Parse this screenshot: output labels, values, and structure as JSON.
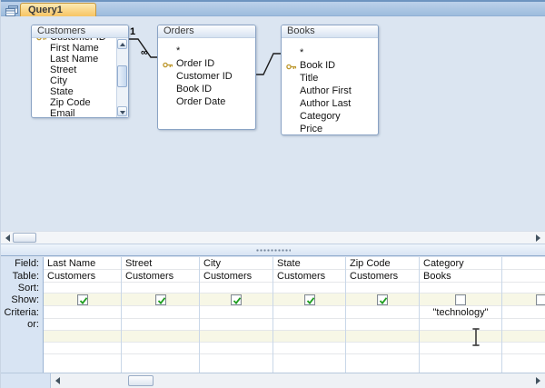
{
  "window": {
    "tab_title": "Query1"
  },
  "diagram": {
    "tables": [
      {
        "name": "Customers",
        "fields": [
          {
            "label": "Customer ID",
            "key": true
          },
          {
            "label": "First Name"
          },
          {
            "label": "Last Name"
          },
          {
            "label": "Street"
          },
          {
            "label": "City"
          },
          {
            "label": "State"
          },
          {
            "label": "Zip Code"
          },
          {
            "label": "Email"
          }
        ],
        "scrolled": true
      },
      {
        "name": "Orders",
        "fields": [
          {
            "label": "*"
          },
          {
            "label": "Order ID",
            "key": true
          },
          {
            "label": "Customer ID"
          },
          {
            "label": "Book ID"
          },
          {
            "label": "Order Date"
          }
        ]
      },
      {
        "name": "Books",
        "fields": [
          {
            "label": "*"
          },
          {
            "label": "Book ID",
            "key": true
          },
          {
            "label": "Title"
          },
          {
            "label": "Author First"
          },
          {
            "label": "Author Last"
          },
          {
            "label": "Category"
          },
          {
            "label": "Price"
          }
        ]
      }
    ],
    "relationships": [
      {
        "from": "Customers",
        "to": "Orders",
        "from_cardinality": "1",
        "to_cardinality": "∞"
      },
      {
        "from": "Orders",
        "to": "Books",
        "from_cardinality": "",
        "to_cardinality": ""
      }
    ]
  },
  "grid": {
    "row_labels": [
      "Field:",
      "Table:",
      "Sort:",
      "Show:",
      "Criteria:",
      "or:"
    ],
    "columns": [
      {
        "field": "Last Name",
        "table": "Customers",
        "sort": "",
        "show": "checked",
        "criteria": "",
        "or": ""
      },
      {
        "field": "Street",
        "table": "Customers",
        "sort": "",
        "show": "checked",
        "criteria": "",
        "or": ""
      },
      {
        "field": "City",
        "table": "Customers",
        "sort": "",
        "show": "checked",
        "criteria": "",
        "or": ""
      },
      {
        "field": "State",
        "table": "Customers",
        "sort": "",
        "show": "checked",
        "criteria": "",
        "or": ""
      },
      {
        "field": "Zip Code",
        "table": "Customers",
        "sort": "",
        "show": "checked",
        "criteria": "",
        "or": ""
      },
      {
        "field": "Category",
        "table": "Books",
        "sort": "",
        "show": "unchecked",
        "criteria": "\"technology\"",
        "or": ""
      },
      {
        "field": "",
        "table": "",
        "sort": "",
        "show": "unchecked",
        "criteria": "",
        "or": ""
      }
    ]
  },
  "colors": {
    "active_tab": "#f7c463",
    "pane_background": "#dbe5f1",
    "grid_header_column": "#d8e4f3",
    "show_row_tint": "#f7f7e6",
    "checkmark_green": "#1f9e1f",
    "key_icon_gold": "#bd982e"
  }
}
